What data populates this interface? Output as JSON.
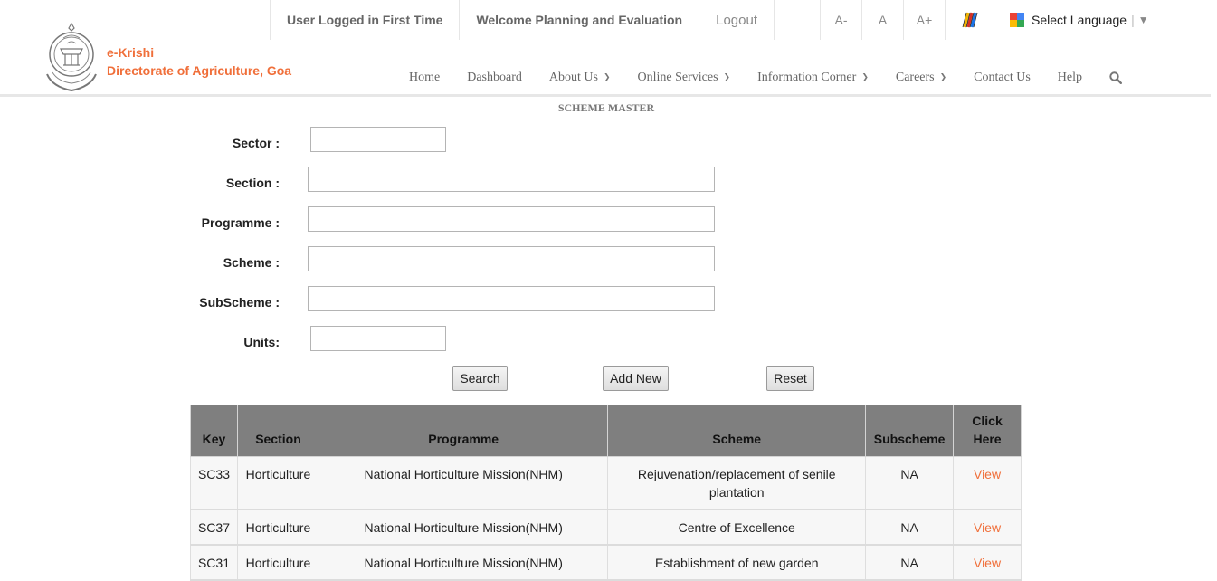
{
  "topbar": {
    "user_status": "User Logged in First Time",
    "welcome": "Welcome Planning and Evaluation",
    "logout": "Logout",
    "font_decrease": "A-",
    "font_normal": "A",
    "font_increase": "A+",
    "accessibility_icon": "contrast-icon",
    "language": "Select Language",
    "language_sep": "|",
    "language_arrow": "▼"
  },
  "brand": {
    "line1": "e-Krishi",
    "line2": "Directorate of Agriculture, Goa",
    "logo_icon": "government-of-goa-emblem"
  },
  "nav": {
    "items": [
      {
        "label": "Home",
        "dropdown": false
      },
      {
        "label": "Dashboard",
        "dropdown": false
      },
      {
        "label": "About Us",
        "dropdown": true
      },
      {
        "label": "Online Services",
        "dropdown": true
      },
      {
        "label": "Information Corner",
        "dropdown": true
      },
      {
        "label": "Careers",
        "dropdown": true
      },
      {
        "label": "Contact Us",
        "dropdown": false
      },
      {
        "label": "Help",
        "dropdown": false
      }
    ],
    "chevron": "⌄",
    "search_icon": "search-icon"
  },
  "page": {
    "title": "SCHEME MASTER"
  },
  "form": {
    "sector_label": "Sector :",
    "sector_value": "",
    "section_label": "Section :",
    "section_value": "",
    "programme_label": "Programme :",
    "programme_value": "",
    "scheme_label": "Scheme :",
    "scheme_value": "",
    "subscheme_label": "SubScheme :",
    "subscheme_value": "",
    "units_label": "Units:",
    "units_value": ""
  },
  "buttons": {
    "search": "Search",
    "add_new": "Add New",
    "reset": "Reset"
  },
  "table": {
    "headers": {
      "key": "Key",
      "section": "Section",
      "programme": "Programme",
      "scheme": "Scheme",
      "subscheme": "Subscheme",
      "click_here_1": "Click",
      "click_here_2": "Here"
    },
    "rows": [
      {
        "key": "SC33",
        "section": "Horticulture",
        "programme": "National Horticulture Mission(NHM)",
        "scheme": "Rejuvenation/replacement of senile plantation",
        "subscheme": "NA",
        "action": "View"
      },
      {
        "key": "SC37",
        "section": "Horticulture",
        "programme": "National Horticulture Mission(NHM)",
        "scheme": "Centre of Excellence",
        "subscheme": "NA",
        "action": "View"
      },
      {
        "key": "SC31",
        "section": "Horticulture",
        "programme": "National Horticulture Mission(NHM)",
        "scheme": "Establishment of new garden",
        "subscheme": "NA",
        "action": "View"
      }
    ]
  },
  "colors": {
    "brand_orange": "#f06f3a",
    "table_header": "#7f7f7f"
  }
}
